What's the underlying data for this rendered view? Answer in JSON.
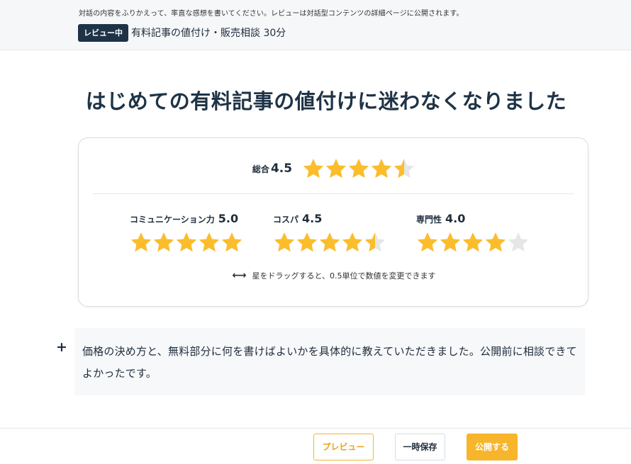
{
  "header": {
    "note": "対話の内容をふりかえって、率直な感想を書いてください。レビューは対話型コンテンツの詳細ページに公開されます。",
    "status_badge": "レビュー中",
    "content_title": "有料記事の値付け・販売相談 30分"
  },
  "review": {
    "title": "はじめての有料記事の値付けに迷わなくなりました",
    "overall": {
      "label": "総合",
      "value": "4.5",
      "rating": 4.5
    },
    "sub_ratings": [
      {
        "label": "コミュニケーション力",
        "value": "5.0",
        "rating": 5.0
      },
      {
        "label": "コスパ",
        "value": "4.5",
        "rating": 4.5
      },
      {
        "label": "専門性",
        "value": "4.0",
        "rating": 4.0
      }
    ],
    "drag_hint": "星をドラッグすると、0.5単位で数値を変更できます",
    "drag_icon": "double-arrow-icon",
    "comment": "価格の決め方と、無料部分に何を書けばよいかを具体的に教えていただきました。公開前に相談できてよかったです。"
  },
  "footer": {
    "preview_label": "プレビュー",
    "save_label": "一時保存",
    "publish_label": "公開する"
  },
  "colors": {
    "star_filled": "#fbbd2b",
    "star_empty": "#e6e6e6",
    "accent": "#f7b52b",
    "badge": "#1f3346"
  }
}
